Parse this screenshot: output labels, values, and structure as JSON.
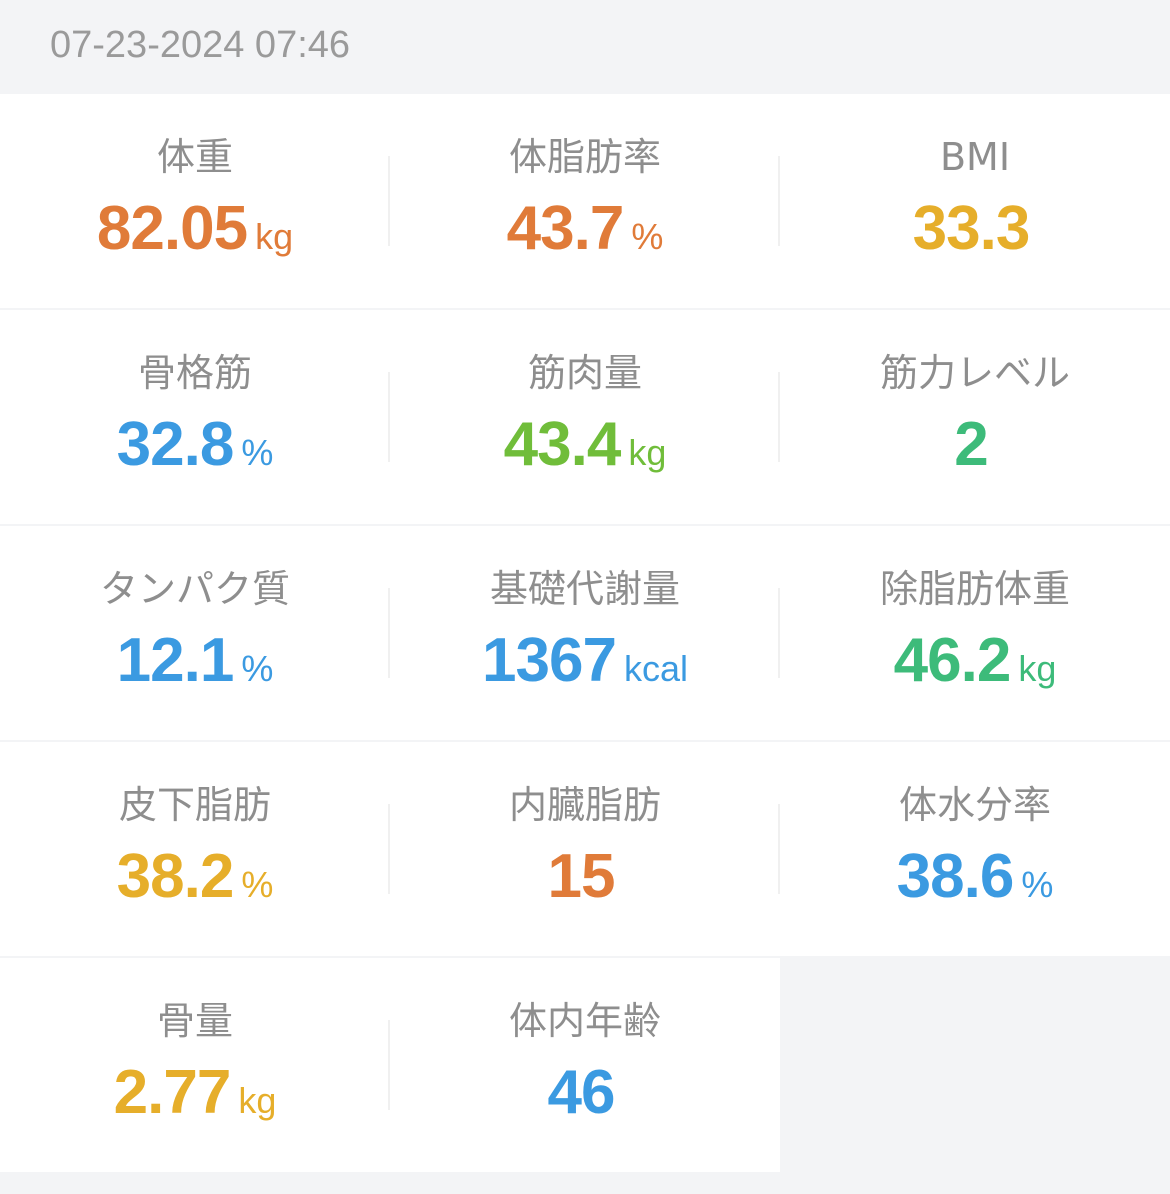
{
  "timestamp": "07-23-2024 07:46",
  "colors": {
    "orange": "#e07b39",
    "yellow": "#e6ae2a",
    "blue": "#3b9ae1",
    "green": "#70bd3a",
    "teal": "#3dbb7a"
  },
  "metrics": [
    {
      "label": "体重",
      "value": "82.05",
      "unit": "kg",
      "color": "#e07b39"
    },
    {
      "label": "体脂肪率",
      "value": "43.7",
      "unit": "%",
      "color": "#e07b39"
    },
    {
      "label": "BMI",
      "value": "33.3",
      "unit": "",
      "color": "#e6ae2a"
    },
    {
      "label": "骨格筋",
      "value": "32.8",
      "unit": "%",
      "color": "#3b9ae1"
    },
    {
      "label": "筋肉量",
      "value": "43.4",
      "unit": "kg",
      "color": "#70bd3a"
    },
    {
      "label": "筋力レベル",
      "value": "2",
      "unit": "",
      "color": "#3dbb7a"
    },
    {
      "label": "タンパク質",
      "value": "12.1",
      "unit": "%",
      "color": "#3b9ae1"
    },
    {
      "label": "基礎代謝量",
      "value": "1367",
      "unit": "kcal",
      "color": "#3b9ae1"
    },
    {
      "label": "除脂肪体重",
      "value": "46.2",
      "unit": "kg",
      "color": "#3dbb7a"
    },
    {
      "label": "皮下脂肪",
      "value": "38.2",
      "unit": "%",
      "color": "#e6ae2a"
    },
    {
      "label": "内臓脂肪",
      "value": "15",
      "unit": "",
      "color": "#e07b39"
    },
    {
      "label": "体水分率",
      "value": "38.6",
      "unit": "%",
      "color": "#3b9ae1"
    },
    {
      "label": "骨量",
      "value": "2.77",
      "unit": "kg",
      "color": "#e6ae2a"
    },
    {
      "label": "体内年齢",
      "value": "46",
      "unit": "",
      "color": "#3b9ae1"
    }
  ]
}
